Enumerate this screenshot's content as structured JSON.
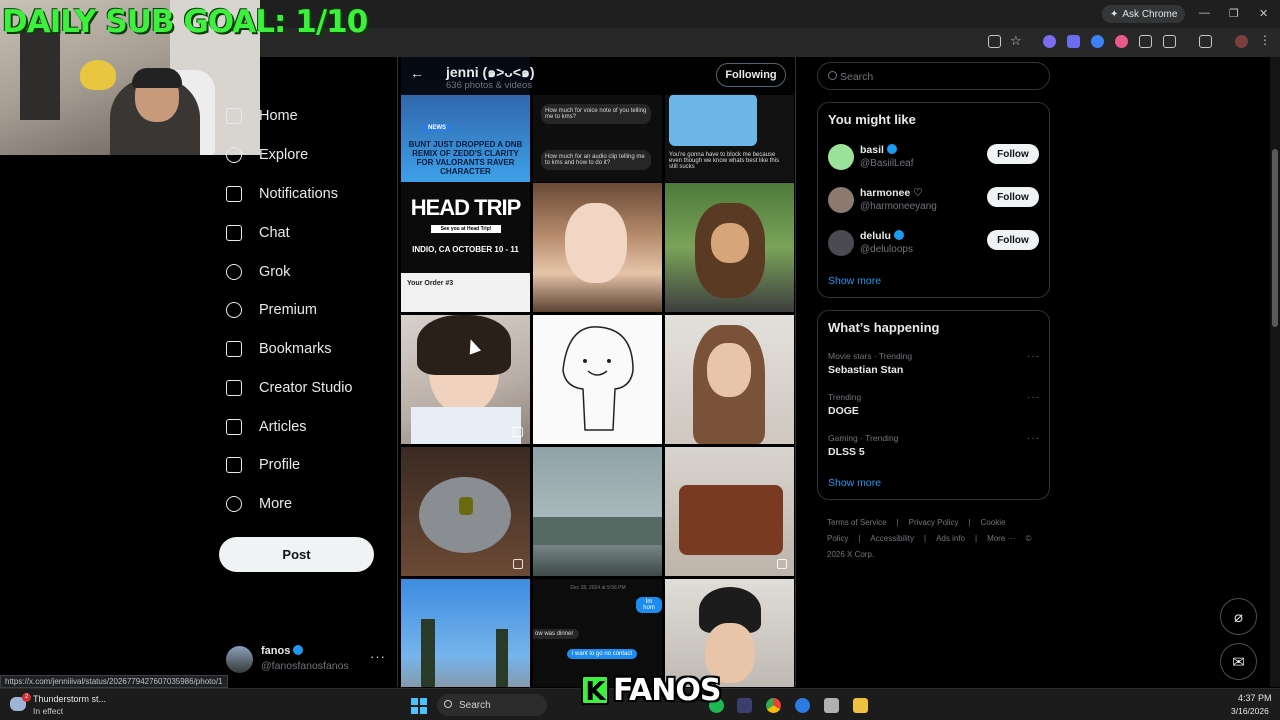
{
  "overlay": {
    "sub_goal": "DAILY SUB GOAL: 1/10",
    "streamer_logo": "FANOS",
    "streamer_logo_initial": "K"
  },
  "browser": {
    "ask_chrome": "Ask Chrome",
    "status_url": "https://x.com/jenniiival/status/2026779427607035986/photo/1"
  },
  "nav": {
    "items": [
      {
        "label": "Home",
        "icon": "home-icon"
      },
      {
        "label": "Explore",
        "icon": "search-icon"
      },
      {
        "label": "Notifications",
        "icon": "bell-icon"
      },
      {
        "label": "Chat",
        "icon": "mail-icon"
      },
      {
        "label": "Grok",
        "icon": "grok-icon"
      },
      {
        "label": "Premium",
        "icon": "x-premium-icon"
      },
      {
        "label": "Bookmarks",
        "icon": "bookmark-icon"
      },
      {
        "label": "Creator Studio",
        "icon": "rocket-icon"
      },
      {
        "label": "Articles",
        "icon": "article-icon"
      },
      {
        "label": "Profile",
        "icon": "person-icon"
      },
      {
        "label": "More",
        "icon": "more-circle-icon"
      }
    ],
    "post_label": "Post",
    "account": {
      "name": "fanos",
      "handle": "@fanosfanosfanos",
      "more": "···"
    }
  },
  "main": {
    "profile_name": "jenni (๑>ᴗ<๑)",
    "media_count": "636 photos & videos",
    "following_label": "Following",
    "tiles": [
      {
        "overlay": "BUNT JUST DROPPED A DNB REMIX OF ZEDD'S CLARITY FOR VALORANTS RAVER CHARACTER",
        "tag": "NEWS"
      },
      {
        "overlay": "How much for voice note of you telling me to kms?"
      },
      {
        "overlay": "You're gonna have to block me because even though we know whats best like this still sucks"
      },
      {
        "overlay": "HEAD TRIP",
        "sub": "INDIO, CA   OCTOBER 10 - 11",
        "extra": "Your Order #3",
        "greeting": "See you at Head Trip!"
      },
      {
        "overlay": ""
      },
      {
        "overlay": ""
      },
      {
        "overlay": ""
      },
      {
        "overlay": ""
      },
      {
        "overlay": ""
      },
      {
        "overlay": ""
      },
      {
        "overlay": ""
      },
      {
        "overlay": ""
      },
      {
        "overlay": ""
      },
      {
        "overlay": "i want to go no contact",
        "date": "Dec 28, 2024 at 9:56 PM",
        "msg": "ow was dinner",
        "reply": "Im hom"
      },
      {
        "overlay": ""
      }
    ]
  },
  "right": {
    "search_placeholder": "Search",
    "you_might_like_title": "You might like",
    "suggestions": [
      {
        "name": "basil",
        "handle": "@BasiilLeaf",
        "follow": "Follow",
        "color": "#9be39a"
      },
      {
        "name": "harmonee ♡",
        "handle": "@harmoneeyang",
        "follow": "Follow",
        "color": "#8c7a70"
      },
      {
        "name": "delulu",
        "handle": "@deluloops",
        "follow": "Follow",
        "color": "#4b4a52"
      }
    ],
    "show_more": "Show more",
    "happening_title": "What’s happening",
    "trends": [
      {
        "category": "Movie stars · Trending",
        "name": "Sebastian Stan"
      },
      {
        "category": "Trending",
        "name": "DOGE"
      },
      {
        "category": "Gaming · Trending",
        "name": "DLSS 5"
      }
    ],
    "show_more_2": "Show more",
    "footer": [
      "Terms of Service",
      "|",
      "Privacy Policy",
      "|",
      "Cookie Policy",
      "|",
      "Accessibility",
      "|",
      "Ads info",
      "|",
      "More ···",
      "© 2026 X Corp."
    ]
  },
  "taskbar": {
    "weather_title": "Thunderstorm st...",
    "weather_sub": "In effect",
    "weather_badge": "2",
    "search_label": "Search",
    "time": "4:37 PM",
    "date": "3/16/2026"
  },
  "colors": {
    "accent": "#1d9bf0",
    "sub_goal_green": "#3df03d",
    "background": "#000000"
  }
}
